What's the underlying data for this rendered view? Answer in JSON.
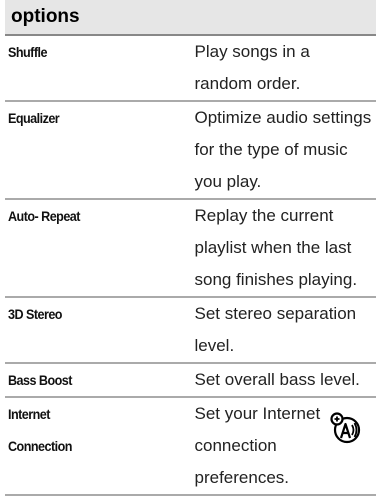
{
  "table": {
    "header": "options",
    "rows": [
      {
        "name": "Shuffle",
        "description": "Play songs in a random order."
      },
      {
        "name": "Equalizer",
        "description": "Optimize audio settings for the type of music you play."
      },
      {
        "name": "Auto- Repeat",
        "description": "Replay the current playlist when the last song finishes playing."
      },
      {
        "name": "3D Stereo",
        "description": "Set stereo separation level."
      },
      {
        "name": "Bass Boost",
        "description": "Set overall bass level."
      },
      {
        "name": "Internet Connection",
        "description": "Set your Internet connection preferences."
      }
    ]
  },
  "icons": {
    "internet_connection": "network-access-icon"
  }
}
